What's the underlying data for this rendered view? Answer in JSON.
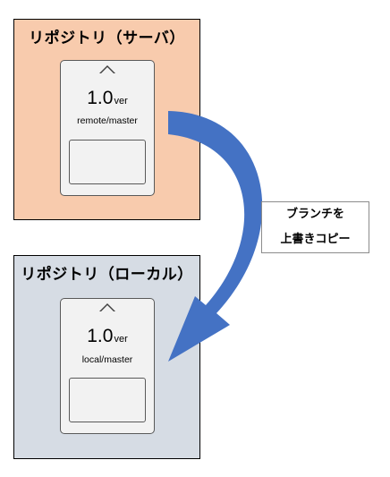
{
  "server": {
    "title": "リポジトリ（サーバ）",
    "bg_color": "#f8cbad",
    "card": {
      "version": "1.0",
      "version_suffix": "ver",
      "branch": "remote/master"
    }
  },
  "local": {
    "title": "リポジトリ（ローカル）",
    "bg_color": "#d6dce4",
    "card": {
      "version": "1.0",
      "version_suffix": "ver",
      "branch": "local/master"
    }
  },
  "callout": {
    "line1": "ブランチを",
    "line2": "上書きコピー"
  },
  "arrow_color": "#4472c4"
}
